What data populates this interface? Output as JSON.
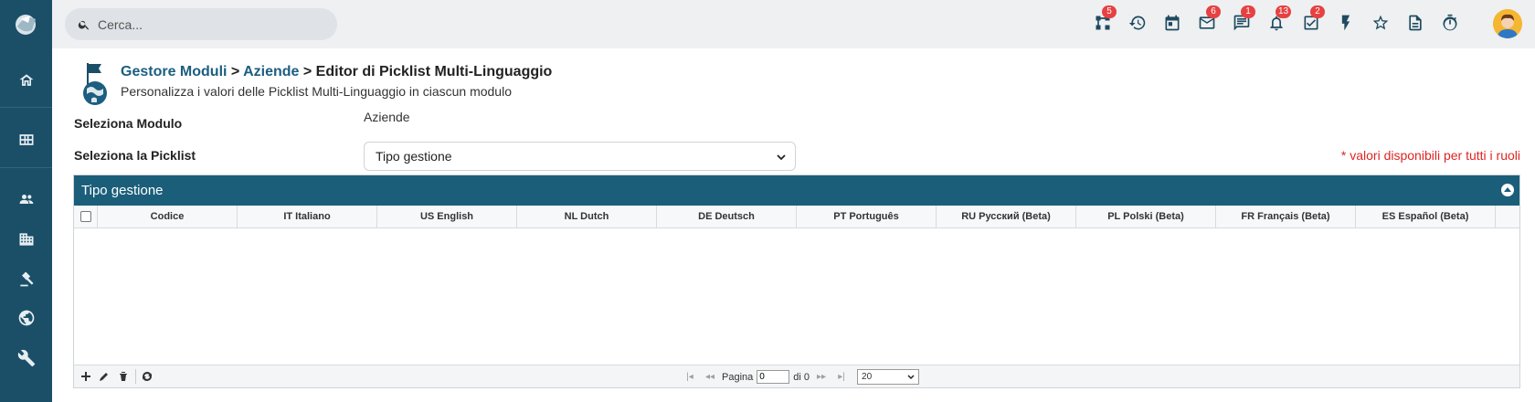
{
  "search": {
    "placeholder": "Cerca..."
  },
  "topbar": {
    "icons": [
      {
        "name": "process-icon",
        "badge": "5"
      },
      {
        "name": "history-icon",
        "badge": ""
      },
      {
        "name": "calendar-icon",
        "badge": ""
      },
      {
        "name": "mail-icon",
        "badge": "6"
      },
      {
        "name": "chat-icon",
        "badge": "1"
      },
      {
        "name": "bell-icon",
        "badge": "13"
      },
      {
        "name": "tasks-icon",
        "badge": "2"
      },
      {
        "name": "bolt-icon",
        "badge": ""
      },
      {
        "name": "star-icon",
        "badge": ""
      },
      {
        "name": "document-icon",
        "badge": ""
      },
      {
        "name": "timer-icon",
        "badge": ""
      }
    ]
  },
  "sidebar": {
    "items": [
      "home-icon",
      "grid-icon",
      "users-icon",
      "building-icon",
      "gavel-icon",
      "globe-icon",
      "wrench-icon"
    ]
  },
  "header": {
    "crumb1": "Gestore Moduli",
    "sep1": " > ",
    "crumb2": "Aziende",
    "sep2": " > ",
    "crumb3": "Editor di Picklist Multi-Linguaggio",
    "subtitle": "Personalizza i valori delle Picklist Multi-Linguaggio in ciascun modulo"
  },
  "form": {
    "module_label": "Seleziona Modulo",
    "module_value": "Aziende",
    "picklist_label": "Seleziona la Picklist",
    "picklist_value": "Tipo gestione",
    "note": "* valori disponibili per tutti i ruoli"
  },
  "grid": {
    "title": "Tipo gestione",
    "columns": [
      "Codice",
      "IT Italiano",
      "US English",
      "NL Dutch",
      "DE Deutsch",
      "PT Português",
      "RU Русский (Beta)",
      "PL Polski (Beta)",
      "FR Français (Beta)",
      "ES Español (Beta)"
    ],
    "rows": [],
    "pager": {
      "page_label": "Pagina",
      "page_value": "0",
      "of_label": "di 0",
      "rows_per_page": "20"
    }
  },
  "colors": {
    "sidebar": "#1b4f67",
    "grid_header": "#1b5e7a",
    "badge": "#e74141",
    "note": "#e02424"
  }
}
